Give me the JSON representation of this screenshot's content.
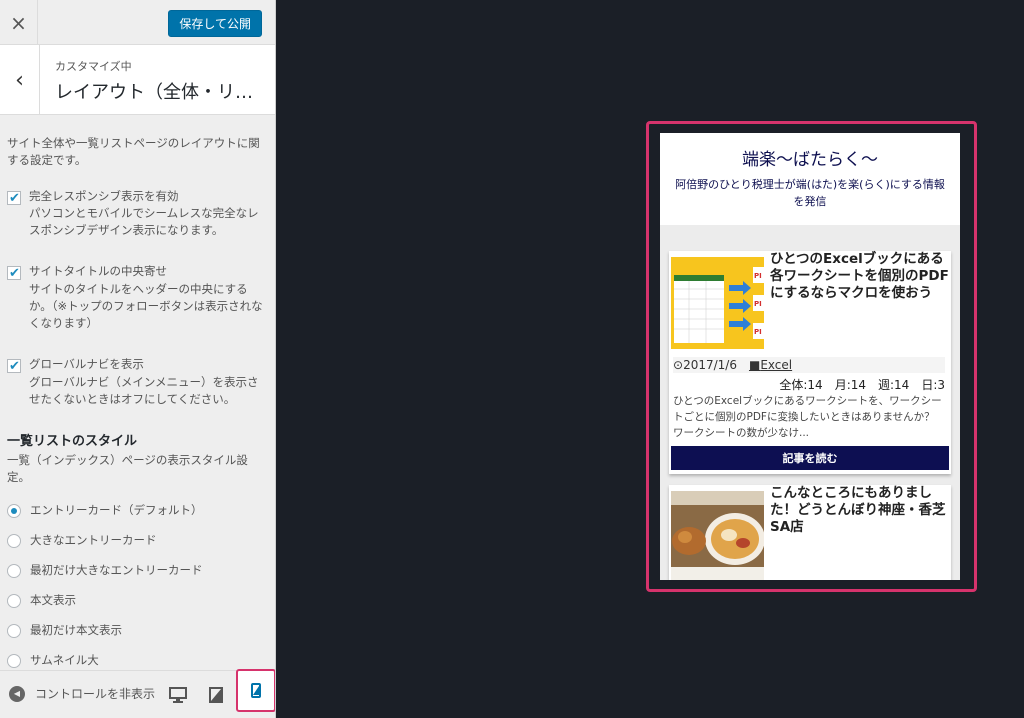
{
  "header": {
    "close_icon": "×",
    "save_label": "保存して公開"
  },
  "section": {
    "back_icon": "‹",
    "breadcrumb": "カスタマイズ中",
    "title": "レイアウト（全体・リスト）"
  },
  "controls": {
    "description": "サイト全体や一覧リストページのレイアウトに関する設定です。",
    "checkboxes": [
      {
        "label": "完全レスポンシブ表示を有効",
        "sub": "パソコンとモバイルでシームレスな完全なレスポンシブデザイン表示になります。",
        "checked": true
      },
      {
        "label": "サイトタイトルの中央寄せ",
        "sub": "サイトのタイトルをヘッダーの中央にするか。（※トップのフォローボタンは表示されなくなります）",
        "checked": true
      },
      {
        "label": "グローバルナビを表示",
        "sub": "グローバルナビ（メインメニュー）を表示させたくないときはオフにしてください。",
        "checked": true
      }
    ],
    "list_style_heading": "一覧リストのスタイル",
    "list_style_desc": "一覧（インデックス）ページの表示スタイル設定。",
    "radios": [
      {
        "label": "エントリーカード（デフォルト）",
        "selected": true
      },
      {
        "label": "大きなエントリーカード",
        "selected": false
      },
      {
        "label": "最初だけ大きなエントリーカード",
        "selected": false
      },
      {
        "label": "本文表示",
        "selected": false
      },
      {
        "label": "最初だけ本文表示",
        "selected": false
      },
      {
        "label": "サムネイル大",
        "selected": false
      }
    ]
  },
  "footer": {
    "hide_controls_label": "コントロールを非表示",
    "devices": [
      "desktop-icon",
      "tablet-icon",
      "mobile-icon"
    ],
    "active_device": "mobile"
  },
  "preview": {
    "site_title": "端楽〜ばたらく〜",
    "site_desc": "阿倍野のひとり税理士が端(はた)を楽(らく)にする情報を発信",
    "cards": [
      {
        "title": "ひとつのExcelブックにある各ワークシートを個別のPDFにするならマクロを使おう",
        "date": "2017/1/6",
        "category": "Excel",
        "stats": "全体:14　月:14　週:14　日:3",
        "excerpt": "ひとつのExcelブックにあるワークシートを、ワークシートごとに個別のPDFに変換したいときはありませんか？ ワークシートの数が少なけ...",
        "read_more": "記事を読む"
      },
      {
        "title": "こんなところにもありました！どうとんぼり神座・香芝SA店"
      }
    ]
  },
  "colors": {
    "accent": "#0073aa",
    "highlight": "#d6336c",
    "site_navy": "#0d0f52",
    "preview_bg": "#1b1f27"
  }
}
